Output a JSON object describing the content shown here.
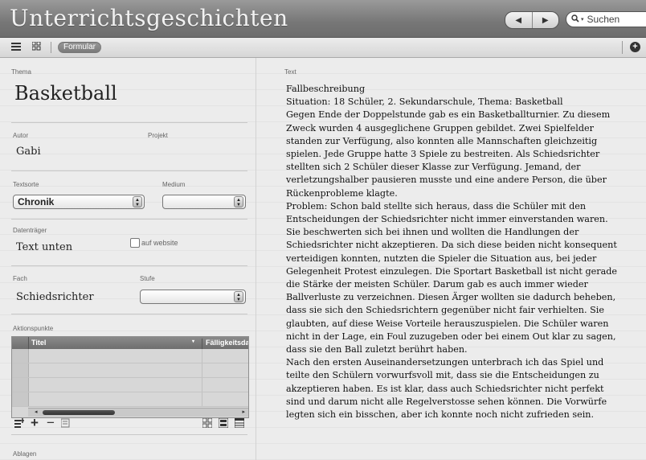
{
  "window": {
    "title": "Unterrichtsgeschichten",
    "nav": {
      "back": "◀",
      "forward": "▶"
    },
    "search_placeholder": "Suchen"
  },
  "toolbar": {
    "mode_label": "Formular"
  },
  "form": {
    "thema_label": "Thema",
    "thema_value": "Basketball",
    "autor_label": "Autor",
    "autor_value": "Gabi",
    "projekt_label": "Projekt",
    "projekt_value": "",
    "textsorte_label": "Textsorte",
    "textsorte_value": "Chronik",
    "medium_label": "Medium",
    "medium_value": "",
    "datentraeger_label": "Datenträger",
    "datentraeger_value": "Text unten",
    "website_label": "auf website",
    "fach_label": "Fach",
    "fach_value": "Schiedsrichter",
    "stufe_label": "Stufe",
    "stufe_value": "",
    "aktionspunkte_label": "Aktionspunkte",
    "ablagen_label": "Ablagen"
  },
  "table": {
    "columns": [
      "Titel",
      "Fälligkeitsdatum"
    ],
    "rows": []
  },
  "text_section": {
    "label": "Text",
    "paragraphs": [
      "Fallbeschreibung",
      "Situation: 18 Schüler, 2. Sekundarschule, Thema: Basketball",
      "Gegen Ende der Doppelstunde gab es ein Basketballturnier. Zu diesem Zweck wurden 4 ausgeglichene Gruppen gebildet. Zwei Spielfelder standen zur Verfügung, also konnten alle Mannschaften gleichzeitig spielen. Jede Gruppe hatte 3 Spiele zu bestreiten. Als Schiedsrichter stellten sich 2 Schüler dieser Klasse zur Verfügung. Jemand, der verletzungshalber pausieren musste und eine andere Person, die über Rückenprobleme klagte.",
      "Problem: Schon bald stellte sich heraus, dass die Schüler mit den Entscheidungen der Schiedsrichter nicht immer einverstanden waren. Sie beschwerten sich bei ihnen und wollten die Handlungen der Schiedsrichter nicht akzeptieren. Da sich diese beiden nicht konsequent verteidigen konnten, nutzten die Spieler die Situation aus, bei jeder Gelegenheit Protest einzulegen. Die Sportart Basketball ist nicht gerade die Stärke der meisten Schüler. Darum gab es auch immer wieder Ballverluste zu verzeichnen. Diesen Ärger wollten sie dadurch beheben, dass sie sich den Schiedsrichtern gegenüber nicht fair verhielten. Sie glaubten, auf diese Weise Vorteile herauszuspielen. Die Schüler waren nicht in der Lage, ein Foul zuzugeben oder bei einem Out klar zu sagen, dass sie den Ball zuletzt berührt haben.",
      "Nach den ersten Auseinandersetzungen unterbrach ich das Spiel und teilte den Schülern vorwurfsvoll mit, dass sie die Entscheidungen zu akzeptieren haben. Es ist klar, dass auch Schiedsrichter nicht perfekt sind und darum nicht alle Regelverstosse sehen können. Die Vorwürfe legten sich ein bisschen, aber ich konnte noch nicht zufrieden sein."
    ]
  },
  "colors": {
    "titlebar": "#777777",
    "background": "#e9e9e9",
    "pill": "#888888"
  }
}
